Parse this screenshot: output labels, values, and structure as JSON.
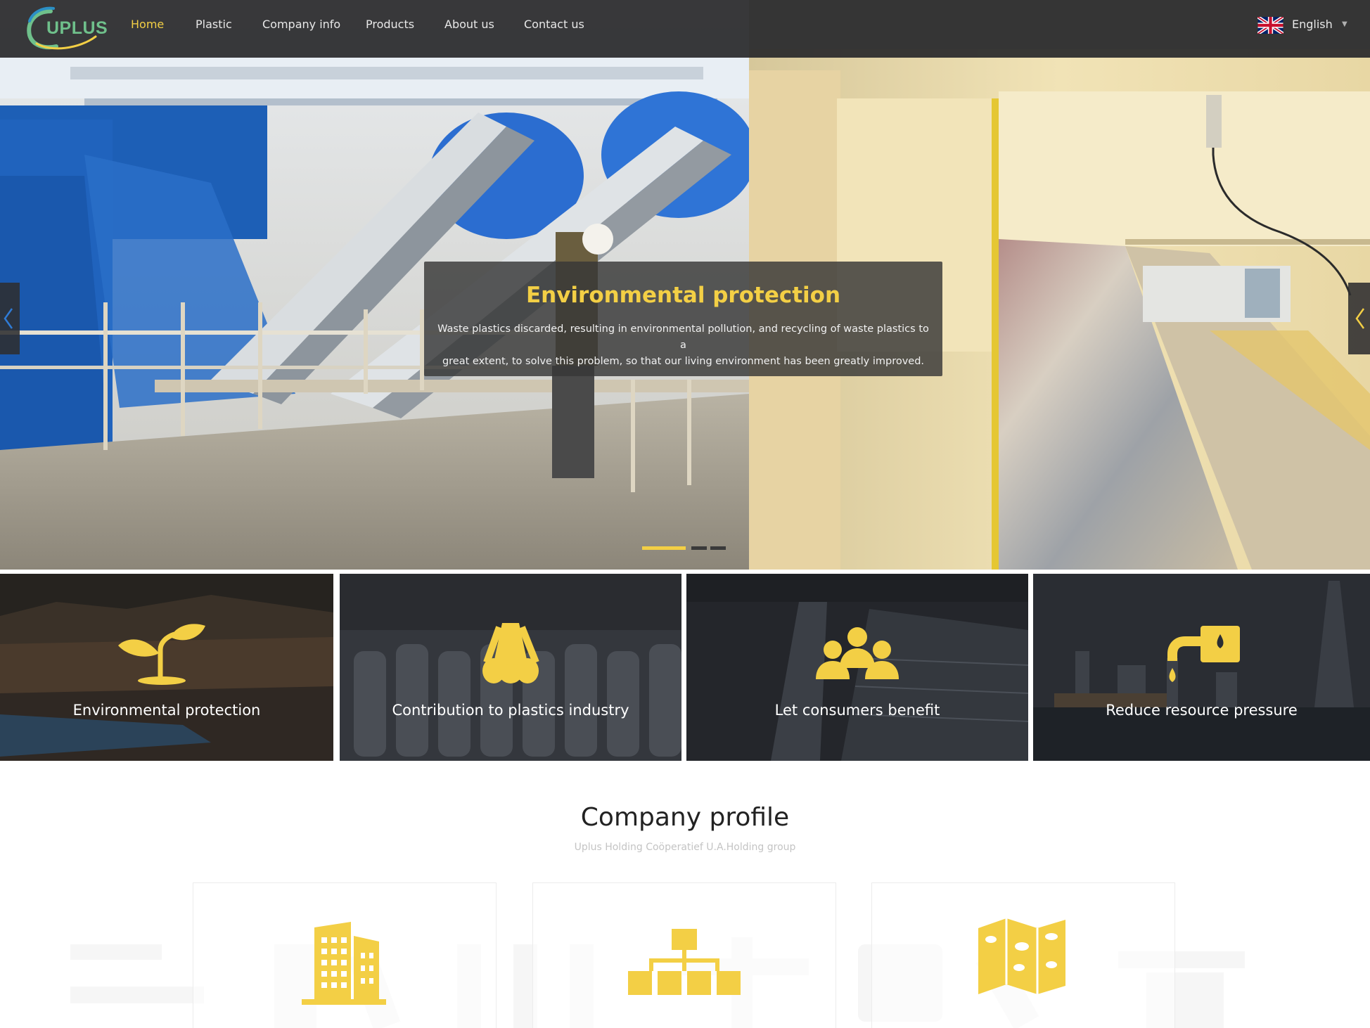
{
  "brand": {
    "logo_text": "UPLUS",
    "accent_color": "#f3cf45",
    "logo_color": "#6fc08b"
  },
  "nav": {
    "items": [
      {
        "label": "Home",
        "active": true
      },
      {
        "label": "Plastic",
        "active": false
      },
      {
        "label": "Company info",
        "active": false
      },
      {
        "label": "Products",
        "active": false
      },
      {
        "label": "About us",
        "active": false
      },
      {
        "label": "Contact us",
        "active": false
      }
    ],
    "language": {
      "label": "English",
      "icon": "uk-flag-icon"
    }
  },
  "hero": {
    "title": "Environmental protection",
    "text_line1": "Waste plastics discarded, resulting in environmental pollution, and recycling of waste plastics to a",
    "text_line2": "great extent, to solve this problem, so that our living environment has been greatly improved.",
    "slide_count": 3,
    "active_slide": 1,
    "prev_icon": "chevron-left-icon",
    "next_icon": "chevron-left-icon"
  },
  "features": [
    {
      "label": "Environmental protection",
      "icon": "sprout-icon"
    },
    {
      "label": "Contribution to plastics industry",
      "icon": "pipes-icon"
    },
    {
      "label": "Let consumers benefit",
      "icon": "people-group-icon"
    },
    {
      "label": "Reduce resource pressure",
      "icon": "oil-nozzle-icon"
    }
  ],
  "profile": {
    "title": "Company profile",
    "subtitle": "Uplus Holding Coöperatief U.A.Holding group",
    "cards": [
      {
        "icon": "building-icon"
      },
      {
        "icon": "org-chart-icon"
      },
      {
        "icon": "map-icon"
      }
    ]
  }
}
